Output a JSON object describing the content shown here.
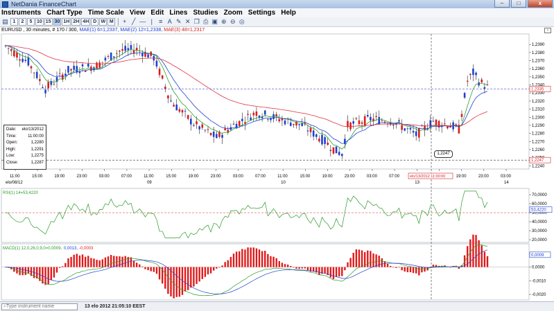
{
  "window": {
    "title": "NetDania FinanceChart",
    "min_glyph": "–",
    "max_glyph": "□",
    "close_glyph": "x"
  },
  "menu": [
    "Instruments",
    "Chart Type",
    "Time Scale",
    "View",
    "Edit",
    "Lines",
    "Studies",
    "Zoom",
    "Settings",
    "Help"
  ],
  "toolbar": {
    "timescales": [
      "1",
      "2",
      "5",
      "10",
      "15",
      "30",
      "1H",
      "2H",
      "4H",
      "D",
      "W",
      "M"
    ],
    "active_timescale": "30",
    "icons": [
      "crosshair-icon",
      "trend-line-icon",
      "horizontal-line-icon",
      "vertical-line-icon",
      "fibonacci-icon",
      "text-icon",
      "pen-icon",
      "delete-icon",
      "copy-icon",
      "print-icon",
      "save-icon",
      "zoom-in-icon",
      "zoom-out-icon",
      "zoom-reset-icon"
    ]
  },
  "info_line": {
    "instrument": "EURUSD , 30 minutes, # 170 / 300,",
    "mae1": "MAE(1) 6=1,2337,",
    "mae2": "MAE(2) 12=1,2338,",
    "mae3": "MAE(3) 48=1,2317"
  },
  "price_panel": {
    "ylim": [
      1.2236,
      1.2403
    ],
    "y_ticks": [
      "1,2390",
      "1,2380",
      "1,2370",
      "1,2360",
      "1,2350",
      "1,2340",
      "1,2330",
      "1,2320",
      "1,2310",
      "1,2300",
      "1,2290",
      "1,2280",
      "1,2270",
      "1,2260",
      "1,2250",
      "1,2240"
    ],
    "current_price_label": "1,2335",
    "cursor_price_label": "1,2247",
    "cursor_price_bubble": "1,2247",
    "x_time_labels": [
      "11:00",
      "15:00",
      "19:00",
      "23:00",
      "03:00",
      "07:00",
      "11:00",
      "15:00",
      "19:00",
      "23:00",
      "03:00",
      "07:00",
      "11:00",
      "15:00",
      "19:00",
      "23:00",
      "03:00",
      "07:00",
      "11:00",
      "15:00",
      "19:00",
      "23:00",
      "03:00"
    ],
    "x_date_labels": [
      "elo/08/12",
      "09",
      "10",
      "13",
      "14"
    ],
    "cursor_time_label": "elo/13/2012 11:00:00"
  },
  "data_window": {
    "date_label": "Date:",
    "date_value": "elo/13/2012",
    "time_label": "Time:",
    "time_value": "11:00:00",
    "open_label": "Open:",
    "open_value": "1,2280",
    "high_label": "High:",
    "high_value": "1,2291",
    "low_label": "Low:",
    "low_value": "1,2275",
    "close_label": "Close:",
    "close_value": "1,2287"
  },
  "rsi_panel": {
    "label": "RSI(1) 14=53,4220",
    "y_ticks": [
      "70,0000",
      "60,0000",
      "50,0000",
      "40,0000",
      "30,0000",
      "20,0000"
    ],
    "current_label": "53,4220"
  },
  "macd_panel": {
    "label_main": "MACD(1) 12,0,26,0,9,0=0,0009,",
    "label_signal": "0,0013,",
    "label_hist": "-0,0003",
    "y_ticks": [
      "0,0010",
      "0,0000",
      "-0,0010",
      "-0,0020"
    ],
    "current_label": "0,0009"
  },
  "colors": {
    "up": "#1f3fd9",
    "down": "#e01a1a",
    "mae1": "#2ca02c",
    "mae2": "#2040d0",
    "mae3": "#e03040",
    "rsi": "#2a9a2a",
    "macd": "#2a9a2a",
    "signal": "#2040d0",
    "hist": "#e01a1a"
  },
  "statusbar": {
    "search_placeholder": "Type instrument name",
    "timestamp": "13 elo 2012 21:05:10 EEST"
  }
}
